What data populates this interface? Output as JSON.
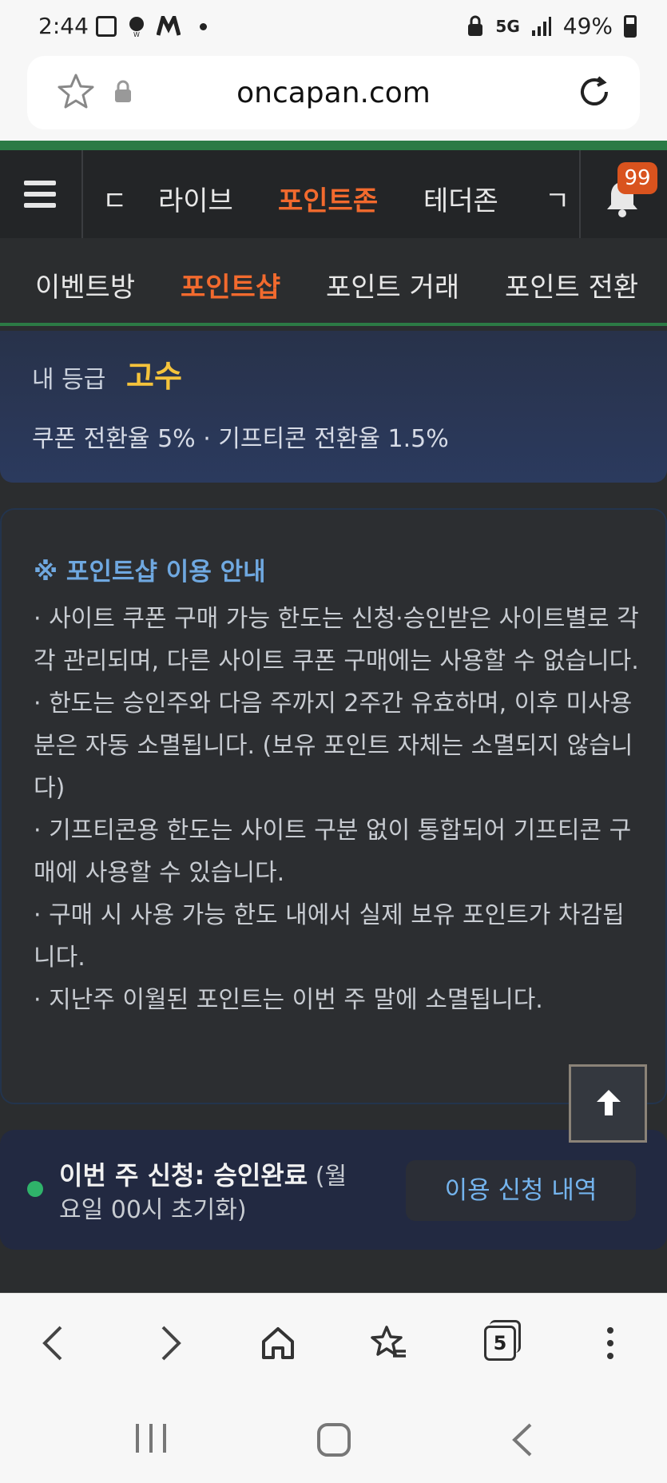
{
  "status_bar": {
    "time": "2:44",
    "network": "5G",
    "battery": "49%",
    "left_icons": [
      "image-icon",
      "won-icon",
      "m-icon",
      "dot-icon"
    ],
    "right_icons": [
      "lock-icon",
      "5g-icon",
      "signal-icon",
      "battery-icon"
    ]
  },
  "browser": {
    "url": "oncapan.com",
    "star_icon": "star-outline-icon",
    "lock_icon": "lock-icon",
    "reload_icon": "reload-icon"
  },
  "header": {
    "menu_icon": "hamburger-icon",
    "tabs": [
      {
        "label": "ㄷ"
      },
      {
        "label": "라이브"
      },
      {
        "label": "포인트존"
      },
      {
        "label": "테더존"
      },
      {
        "label": "ㄱ"
      }
    ],
    "active_tab": "포인트존",
    "bell_icon": "bell-icon",
    "notification_count": "99"
  },
  "subnav": {
    "tabs": [
      {
        "label": "이벤트방"
      },
      {
        "label": "포인트샵"
      },
      {
        "label": "포인트 거래"
      },
      {
        "label": "포인트 전환"
      }
    ],
    "active_tab": "포인트샵"
  },
  "grade": {
    "label": "내 등급",
    "value": "고수",
    "rates": "쿠폰 전환율 5% · 기프티콘 전환율 1.5%"
  },
  "guide": {
    "title": "※ 포인트샵 이용 안내",
    "items": [
      "· 사이트 쿠폰 구매 가능 한도는 신청·승인받은 사이트별로 각각 관리되며, 다른 사이트 쿠폰 구매에는 사용할 수 없습니다.",
      "· 한도는 승인주와 다음 주까지 2주간 유효하며, 이후 미사용분은 자동 소멸됩니다. (보유 포인트 자체는 소멸되지 않습니다)",
      "· 기프티콘용 한도는 사이트 구분 없이 통합되어 기프티콘 구매에 사용할 수 있습니다.",
      "· 구매 시 사용 가능 한도 내에서 실제 보유 포인트가 차감됩니다.",
      "· 지난주 이월된 포인트는 이번 주 말에 소멸됩니다."
    ]
  },
  "request": {
    "status_strong": "이번 주 신청: 승인완료",
    "status_note": "(월요일 00시 초기화)",
    "button_label": "이용 신청 내역",
    "status_color": "#2fb36a"
  },
  "floating": {
    "top_icon": "arrow-up-icon"
  },
  "toolbar": {
    "back_icon": "back-icon",
    "forward_icon": "forward-icon",
    "home_icon": "home-icon",
    "bookmarks_icon": "bookmarks-icon",
    "tabs_count": "5",
    "menu_icon": "more-vertical-icon"
  },
  "system_nav": {
    "recents_icon": "recents-icon",
    "home_icon": "system-home-icon",
    "back_icon": "system-back-icon"
  },
  "colors": {
    "accent": "#f26a2e",
    "grade": "#f5c33b",
    "link": "#74b4ee",
    "guide_title": "#6fa8e0",
    "green": "#2c7a45"
  }
}
